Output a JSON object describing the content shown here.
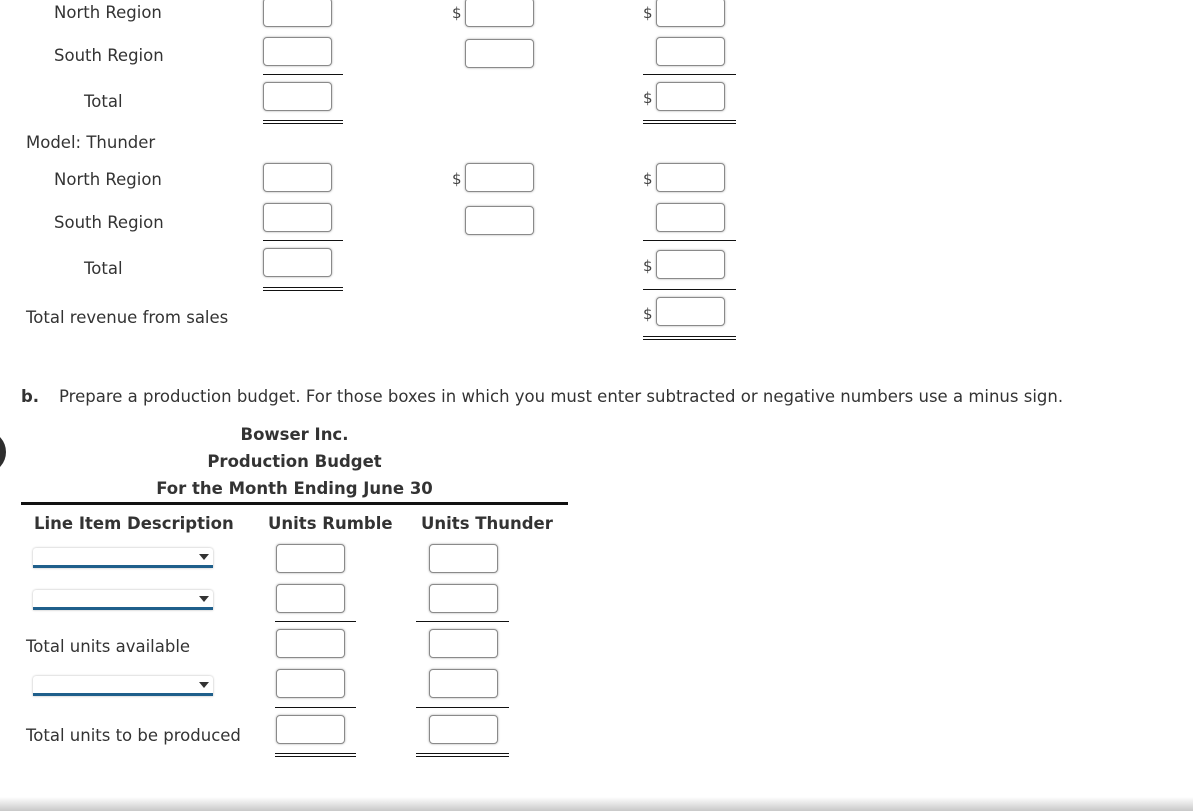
{
  "part_a": {
    "rumble_rows": [
      {
        "label": "North Region",
        "units": "",
        "price_prefix": "$",
        "price": "",
        "revenue_prefix": "$",
        "revenue": ""
      },
      {
        "label": "South Region",
        "units": "",
        "price": "",
        "revenue": ""
      },
      {
        "label": "Total",
        "units": "",
        "revenue_prefix": "$",
        "revenue": ""
      }
    ],
    "thunder_heading": "Model: Thunder",
    "thunder_rows": [
      {
        "label": "North Region",
        "units": "",
        "price_prefix": "$",
        "price": "",
        "revenue_prefix": "$",
        "revenue": ""
      },
      {
        "label": "South Region",
        "units": "",
        "price": "",
        "revenue": ""
      },
      {
        "label": "Total",
        "units": "",
        "revenue_prefix": "$",
        "revenue": ""
      }
    ],
    "total_revenue": {
      "label": "Total revenue from sales",
      "prefix": "$",
      "value": ""
    }
  },
  "part_b": {
    "marker": "b.",
    "instruction": "Prepare a production budget. For those boxes in which you must enter subtracted or negative numbers use a minus sign.",
    "company": "Bowser Inc.",
    "title": "Production Budget",
    "period": "For the Month Ending June 30",
    "columns": [
      "Line Item Description",
      "Units Rumble",
      "Units Thunder"
    ],
    "rows": [
      {
        "type": "select",
        "selected": "",
        "rumble": "",
        "thunder": ""
      },
      {
        "type": "select",
        "selected": "",
        "rumble": "",
        "thunder": ""
      },
      {
        "type": "label",
        "label": "Total units available",
        "rumble": "",
        "thunder": ""
      },
      {
        "type": "select",
        "selected": "",
        "rumble": "",
        "thunder": ""
      },
      {
        "type": "label",
        "label": "Total units to be produced",
        "rumble": "",
        "thunder": ""
      }
    ]
  },
  "colors": {
    "select_underline": "#1f5f8b",
    "text": "#333333"
  }
}
